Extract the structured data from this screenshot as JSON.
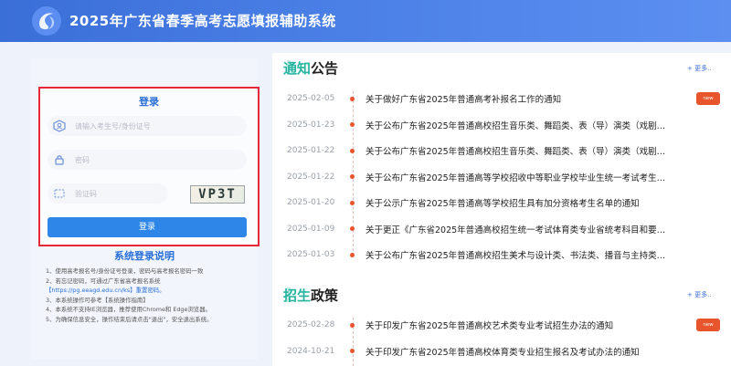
{
  "header": {
    "title": "2025年广东省春季高考志愿填报辅助系统",
    "logo_icon": "swirl-logo-icon"
  },
  "login": {
    "title": "登录",
    "username_placeholder": "请输入考生号/身份证号",
    "password_placeholder": "密码",
    "captcha_placeholder": "验证码",
    "captcha_text": "VP3T",
    "submit_label": "登录"
  },
  "instructions": {
    "title": "系统登录说明",
    "lines": [
      "1、使用高考报名号/身份证号登录，密码与高考报名密码一致",
      "2、若忘记密码，可通过广东省高考报名系统",
      "【https://pg.eeagd.edu.cn/ks】重置密码。",
      "3、本系统操作可参考【系统操作指南】",
      "4、本系统不支持IE浏览器，推荐使用Chrome和 Edge浏览器。",
      "5、为确保信息安全，操作结束后请点击\"退出\"，安全退出系统。"
    ]
  },
  "notices": {
    "heading_highlight": "通知",
    "heading_rest": "公告",
    "more_label": "+ 更多..",
    "new_label": "new",
    "items": [
      {
        "date": "2025-02-05",
        "title": "关于做好广东省2025年普通高考补报名工作的通知",
        "is_new": true
      },
      {
        "date": "2025-01-23",
        "title": "关于公布广东省2025年普通高校招生音乐类、舞蹈类、表（导）演类（戏剧…",
        "is_new": false
      },
      {
        "date": "2025-01-22",
        "title": "关于公布广东省2025年普通高校招生音乐类、舞蹈类、表（导）演类（戏剧…",
        "is_new": false
      },
      {
        "date": "2025-01-22",
        "title": "关于公布广东省2025年普通高等学校招收中等职业学校毕业生统一考试考生…",
        "is_new": false
      },
      {
        "date": "2025-01-20",
        "title": "关于公示广东省2025年普通高等学校招生具有加分资格考生名单的通知",
        "is_new": false
      },
      {
        "date": "2025-01-09",
        "title": "关于更正《广东省2025年普通高校招生统一考试体育类专业省统考科目和要…",
        "is_new": false
      },
      {
        "date": "2025-01-03",
        "title": "关于公布广东省2025年普通高校招生美术与设计类、书法类、播音与主持类…",
        "is_new": false
      }
    ]
  },
  "policies": {
    "heading_highlight": "招生",
    "heading_rest": "政策",
    "more_label": "+ 更多..",
    "new_label": "new",
    "items": [
      {
        "date": "2025-02-28",
        "title": "关于印发广东省2025年普通高校艺术类专业考试招生办法的通知",
        "is_new": true
      },
      {
        "date": "2024-10-21",
        "title": "关于印发广东省2025年普通高校体育类专业招生报名及考试办法的通知",
        "is_new": false
      }
    ]
  },
  "colors": {
    "header_blue": "#3b6fd8",
    "accent_teal": "#27b5a0",
    "login_border_red": "#e8283a",
    "new_badge_orange": "#e8542c",
    "button_blue": "#2d86e8"
  }
}
